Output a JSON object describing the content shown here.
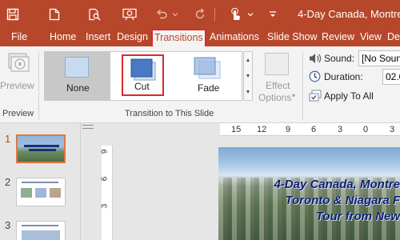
{
  "window": {
    "title": "4-Day Canada, Montrea"
  },
  "qat": [
    "save-icon",
    "new-file-icon",
    "search-file-icon",
    "slideshow-icon",
    "undo-icon",
    "redo-icon",
    "touch-mode-icon",
    "customize-chevron-icon"
  ],
  "tabs": [
    "File",
    "Home",
    "Insert",
    "Design",
    "Transitions",
    "Animations",
    "Slide Show",
    "Review",
    "View",
    "De"
  ],
  "active_tab": "Transitions",
  "ribbon": {
    "preview": {
      "button_label": "Preview",
      "group_label": "Preview"
    },
    "transitions": {
      "items": [
        {
          "label": "None"
        },
        {
          "label": "Cut",
          "selected": true
        },
        {
          "label": "Fade"
        }
      ],
      "effect_options_line1": "Effect",
      "effect_options_line2": "Options",
      "group_label": "Transition to This Slide"
    },
    "timing": {
      "sound_label": "Sound:",
      "sound_value": "[No Soun",
      "duration_label": "Duration:",
      "duration_value": "02.0",
      "apply_all_label": "Apply To All"
    }
  },
  "slides_pane": {
    "thumbnails": [
      {
        "number": "1",
        "active": true
      },
      {
        "number": "2",
        "active": false
      },
      {
        "number": "3",
        "active": false
      }
    ]
  },
  "ruler": {
    "horizontal": [
      "15",
      "12",
      "9",
      "6",
      "3",
      "0",
      "3"
    ],
    "vertical": [
      "9",
      "6",
      "3"
    ]
  },
  "slide": {
    "title_lines": [
      "4-Day Canada, Montre",
      "Toronto & Niagara F",
      "Tour from New"
    ]
  },
  "colors": {
    "accent": "#b7472a",
    "highlight": "#d9292b",
    "ribbon_bg": "#f3f3f3",
    "slide_title": "#0d1d6e"
  }
}
